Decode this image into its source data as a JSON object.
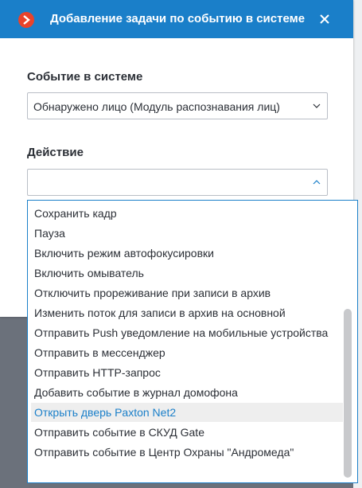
{
  "dialog": {
    "title": "Добавление задачи по событию в системе",
    "close_label": "×"
  },
  "event_field": {
    "label": "Событие в системе",
    "value": "Обнаружено лицо (Модуль распознавания лиц)"
  },
  "action_field": {
    "label": "Действие",
    "value": ""
  },
  "action_options": [
    "Сохранить кадр",
    "Пауза",
    "Включить режим автофокусировки",
    "Включить омыватель",
    "Отключить прореживание при записи в архив",
    "Изменить поток для записи в архив на основной",
    "Отправить Push уведомление на мобильные устройства",
    "Отправить в мессенджер",
    "Отправить HTTP-запрос",
    "Добавить событие в журнал домофона",
    "Открыть дверь Paxton Net2",
    "Отправить событие в СКУД Gate",
    "Отправить событие в Центр Охраны \"Андромеда\""
  ],
  "highlighted_option": "Открыть дверь Paxton Net2",
  "colors": {
    "accent": "#1a7fc9",
    "logo": "#e8432b",
    "text": "#2b2f36",
    "highlight_bg": "#eeeeee"
  },
  "icons": {
    "logo": "app-logo-icon",
    "close": "close-icon",
    "chevron_down": "chevron-down-icon",
    "chevron_up": "chevron-up-icon"
  }
}
